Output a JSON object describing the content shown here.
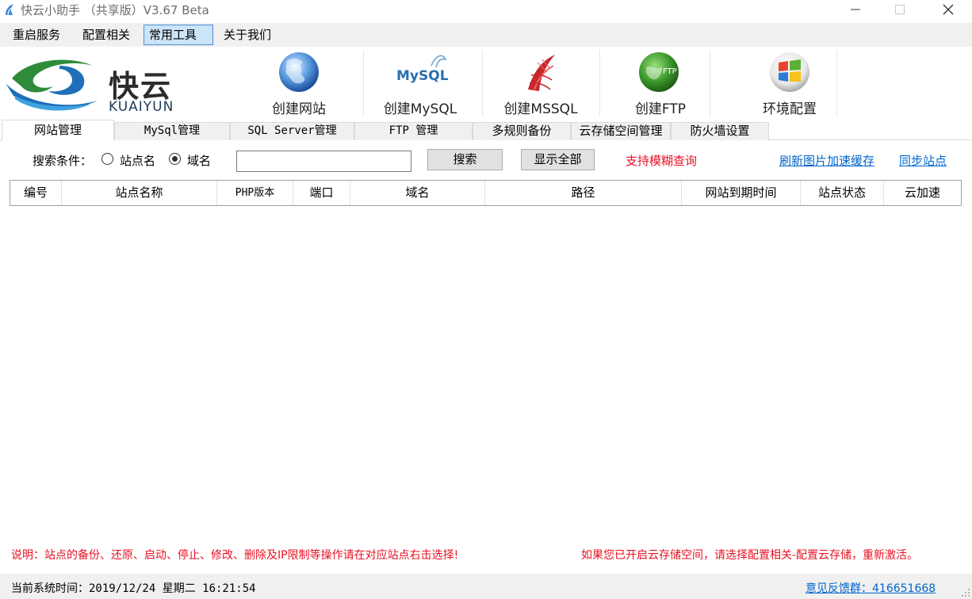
{
  "window": {
    "title": "快云小助手 （共享版）V3.67 Beta"
  },
  "menu": {
    "items": [
      {
        "label": "重启服务"
      },
      {
        "label": "配置相关"
      },
      {
        "label": "常用工具",
        "active": true
      },
      {
        "label": "关于我们"
      }
    ]
  },
  "logo": {
    "cn": "快云",
    "en": "KUAIYUN"
  },
  "toolbar": {
    "tools": [
      {
        "label": "创建网站",
        "icon": "globe-icon"
      },
      {
        "label": "创建MySQL",
        "icon": "mysql-icon",
        "logo_text": "MySQL"
      },
      {
        "label": "创建MSSQL",
        "icon": "mssql-icon"
      },
      {
        "label": "创建FTP",
        "icon": "ftp-icon",
        "logo_text": "FTP"
      },
      {
        "label": "环境配置",
        "icon": "windows-icon"
      }
    ]
  },
  "tabs": [
    {
      "label": "网站管理",
      "active": true
    },
    {
      "label": "MySql管理"
    },
    {
      "label": "SQL Server管理"
    },
    {
      "label": "FTP 管理"
    },
    {
      "label": "多规则备份"
    },
    {
      "label": "云存储空间管理"
    },
    {
      "label": "防火墙设置"
    }
  ],
  "search": {
    "condition_label": "搜索条件：",
    "options": [
      {
        "label": "站点名",
        "checked": false
      },
      {
        "label": "域名",
        "checked": true
      }
    ],
    "input_value": "",
    "search_button": "搜索",
    "show_all_button": "显示全部",
    "fuzzy_note": "支持模糊查询",
    "refresh_link": "刷新图片加速缓存",
    "sync_link": "同步站点"
  },
  "table": {
    "columns": [
      "编号",
      "站点名称",
      "PHP版本",
      "端口",
      "域名",
      "路径",
      "网站到期时间",
      "站点状态",
      "云加速"
    ],
    "rows": []
  },
  "notes": {
    "left": "说明：站点的备份、还原、启动、停止、修改、删除及IP限制等操作请在对应站点右击选择!",
    "right": "如果您已开启云存储空间，请选择配置相关-配置云存储，重新激活。"
  },
  "status": {
    "time": "当前系统时间：2019/12/24 星期二 16:21:54",
    "feedback": "意见反馈群：416651668"
  },
  "colors": {
    "accent_red": "#e81123",
    "link_blue": "#0066cc",
    "menu_active_bg": "#cce4f7",
    "menu_active_border": "#4a8fd4"
  }
}
